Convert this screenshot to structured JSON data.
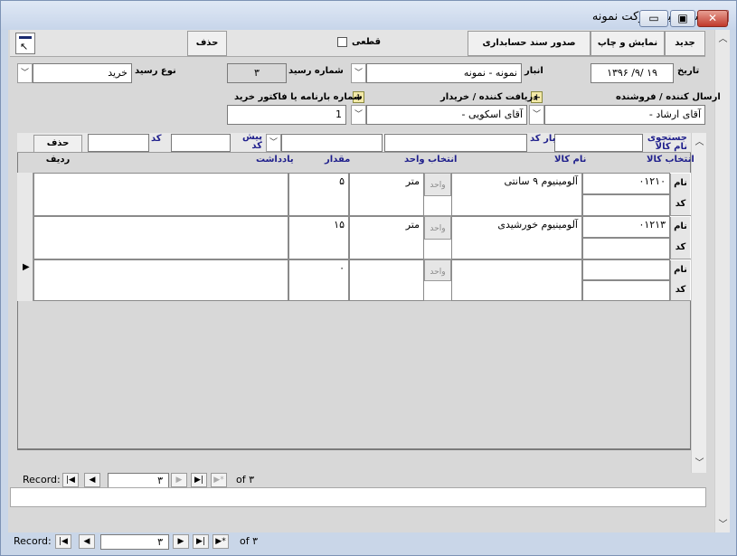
{
  "window": {
    "title": "رسید انبار شرکت نمونه",
    "minimize": "▭",
    "restore": "▣",
    "close": "✕"
  },
  "toolbar": {
    "new_label": "جدید",
    "print_label": "نمایش و چاپ",
    "accounting_label": "صدور سند حسابداری",
    "final_label": "قطعی",
    "delete_label": "حذف",
    "corner_icon": "arrow-up-left-icon"
  },
  "header": {
    "date_label": "تاریخ",
    "date_value": "۱۹ /۹/ ۱۳۹۶",
    "warehouse_label": "انبار",
    "warehouse_value": "نمونه - نمونه",
    "receipt_no_label": "شماره رسید",
    "receipt_no_value": "۳",
    "receipt_type_label": "نوع رسید",
    "receipt_type_value": "خرید",
    "sender_label": "ارسال کننده / فروشنده",
    "sender_value": "آقای ارشاد -",
    "receiver_label": "دریافت کننده / خریدار",
    "receiver_value": "آقای اسکویی -",
    "invoice_label": "شماره بارنامه یا فاکتور خرید",
    "invoice_value": "1"
  },
  "subform": {
    "search_label": "جستجوی نام کالا",
    "barcode_label": "بار کد",
    "prefix_label": "پیش کد",
    "code_label": "کد",
    "delete_row_label": "حذف ردیف",
    "columns": {
      "select_item": "انتخاب کالا",
      "item_name": "نام کالا",
      "select_unit": "انتخاب واحد",
      "quantity": "مقدار",
      "note": "یادداشت"
    },
    "tag_name": "نام",
    "tag_code": "کد",
    "unit_button": "واحد",
    "rows": [
      {
        "item_code": "۰۱۲۱۰",
        "item_name": "آلومینیوم ۹ سانتی",
        "unit": "متر",
        "quantity": "۵",
        "note": ""
      },
      {
        "item_code": "۰۱۲۱۳",
        "item_name": "آلومینیوم خورشیدی",
        "unit": "متر",
        "quantity": "۱۵",
        "note": ""
      },
      {
        "item_code": "",
        "item_name": "",
        "unit": "",
        "quantity": "۰",
        "note": ""
      }
    ],
    "record_label": "Record:",
    "record_value": "۳",
    "record_of": "of ۳"
  },
  "mainnav": {
    "record_label": "Record:",
    "record_value": "۳",
    "record_of": "of ۳"
  }
}
